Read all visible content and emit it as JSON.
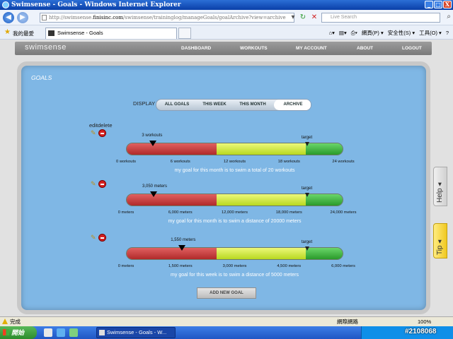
{
  "window": {
    "title": "Swimsense - Goals - Windows Internet Explorer",
    "minimize": "_",
    "maximize": "□",
    "close": "X"
  },
  "address_bar": {
    "url_prefix": "http://swimsense.",
    "url_domain": "finisinc.com",
    "url_rest": "/swimsense/traininglog/manageGoals/goalArchive?view=archive",
    "search_placeholder": "Live Search"
  },
  "favorites_bar": {
    "favorites_label": "我的最愛",
    "tab_title": "Swimsense - Goals",
    "commands": [
      "網頁(P) ▾",
      "安全性(S) ▾",
      "工具(O) ▾",
      "?"
    ]
  },
  "site_nav": {
    "logo": "swimsense",
    "items": [
      "DASHBOARD",
      "WORKOUTS",
      "MY ACCOUNT",
      "ABOUT",
      "LOGOUT"
    ]
  },
  "goals": {
    "title": "GOALS",
    "display_label": "DISPLAY",
    "filters": [
      "ALL GOALS",
      "THIS WEEK",
      "THIS MONTH",
      "ARCHIVE"
    ],
    "selected_filter": "ARCHIVE",
    "edit_delete_label": "editdelete",
    "target_label": "target",
    "items": [
      {
        "current_label": "3 workouts",
        "current_value": 3,
        "target_value": 20,
        "max_value": 24,
        "ticks": [
          "0 workouts",
          "6 workouts",
          "12 workouts",
          "18 workouts",
          "24 workouts"
        ],
        "caption": "my goal for this month is to swim a total of 20 workouts"
      },
      {
        "current_label": "3,050 meters",
        "current_value": 3050,
        "target_value": 20000,
        "max_value": 24000,
        "ticks": [
          "0 meters",
          "6,000 meters",
          "12,000 meters",
          "18,000 meters",
          "24,000 meters"
        ],
        "caption": "my goal for this month is to swim a distance of 20000 meters"
      },
      {
        "current_label": "1,550 meters",
        "current_value": 1550,
        "target_value": 5000,
        "max_value": 6000,
        "ticks": [
          "0 meters",
          "1,500 meters",
          "3,000 meters",
          "4,500 meters",
          "6,000 meters"
        ],
        "caption": "my goal for this week is to swim a distance of 5000 meters"
      }
    ],
    "add_button": "ADD NEW GOAL"
  },
  "side_tabs": {
    "help": "Help ◂",
    "tip": "Tip ◂"
  },
  "status_bar": {
    "status": "完成",
    "zone": "網際網路",
    "zoom": "100%"
  },
  "taskbar": {
    "start": "開始",
    "task": "Swimsense - Goals - W...",
    "clock": "#2108068"
  }
}
